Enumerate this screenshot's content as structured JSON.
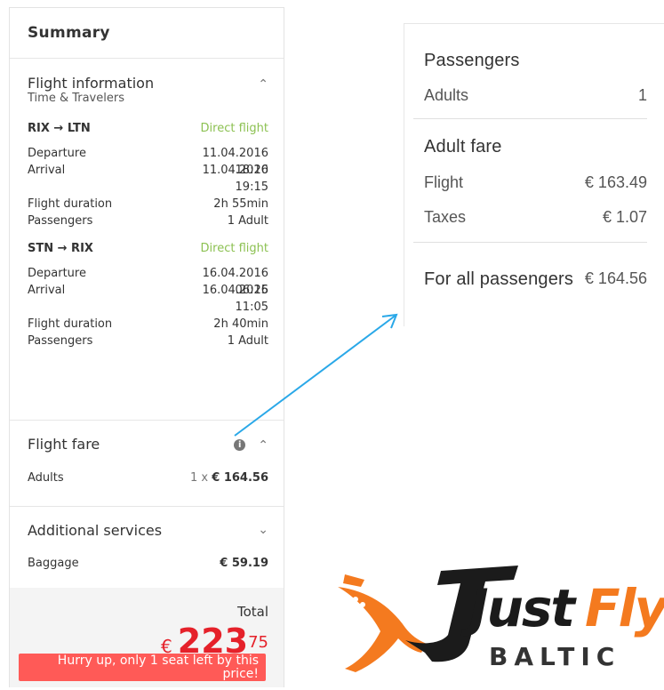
{
  "summary": {
    "title": "Summary",
    "flight_info": {
      "title": "Flight information",
      "subtitle": "Time & Travelers",
      "legs": [
        {
          "route": "RIX → LTN",
          "type": "Direct flight",
          "departure_label": "Departure",
          "departure_date": "11.04.2016",
          "departure_time": "18:20",
          "arrival_label": "Arrival",
          "arrival_date": "11.04.2016",
          "arrival_time": "19:15",
          "duration_label": "Flight duration",
          "duration": "2h 55min",
          "passengers_label": "Passengers",
          "passengers": "1 Adult"
        },
        {
          "route": "STN → RIX",
          "type": "Direct flight",
          "departure_label": "Departure",
          "departure_date": "16.04.2016",
          "departure_time": "06:25",
          "arrival_label": "Arrival",
          "arrival_date": "16.04.2016",
          "arrival_time": "11:05",
          "duration_label": "Flight duration",
          "duration": "2h 40min",
          "passengers_label": "Passengers",
          "passengers": "1 Adult"
        }
      ]
    },
    "flight_fare": {
      "title": "Flight fare",
      "adults_label": "Adults",
      "adults_qty": "1 x",
      "adults_value": "€ 164.56"
    },
    "additional": {
      "title": "Additional services",
      "baggage_label": "Baggage",
      "baggage_value": "€ 59.19"
    },
    "total": {
      "label": "Total",
      "currency": "€",
      "amount": "223",
      "cents": "75",
      "hurry": "Hurry up, only 1 seat left by this price!"
    }
  },
  "zoom": {
    "passengers_title": "Passengers",
    "adults_label": "Adults",
    "adults_count": "1",
    "adult_fare_title": "Adult fare",
    "flight_label": "Flight",
    "flight_value": "€ 163.49",
    "taxes_label": "Taxes",
    "taxes_value": "€ 1.07",
    "all_label": "For all passengers",
    "all_value": "€ 164.56"
  },
  "logo": {
    "word1": "Just",
    "word2": "Fly",
    "word3": "BALTIC"
  },
  "colors": {
    "direct": "#8cc152",
    "price_red": "#e5212a",
    "hurry_bg": "#ff5a57",
    "arrow": "#2aa8e8",
    "logo_orange": "#f47a1f"
  },
  "icons": {
    "collapse": "chevron-up-icon",
    "expand": "chevron-down-icon",
    "info": "info-icon",
    "plane": "airplane-icon"
  }
}
